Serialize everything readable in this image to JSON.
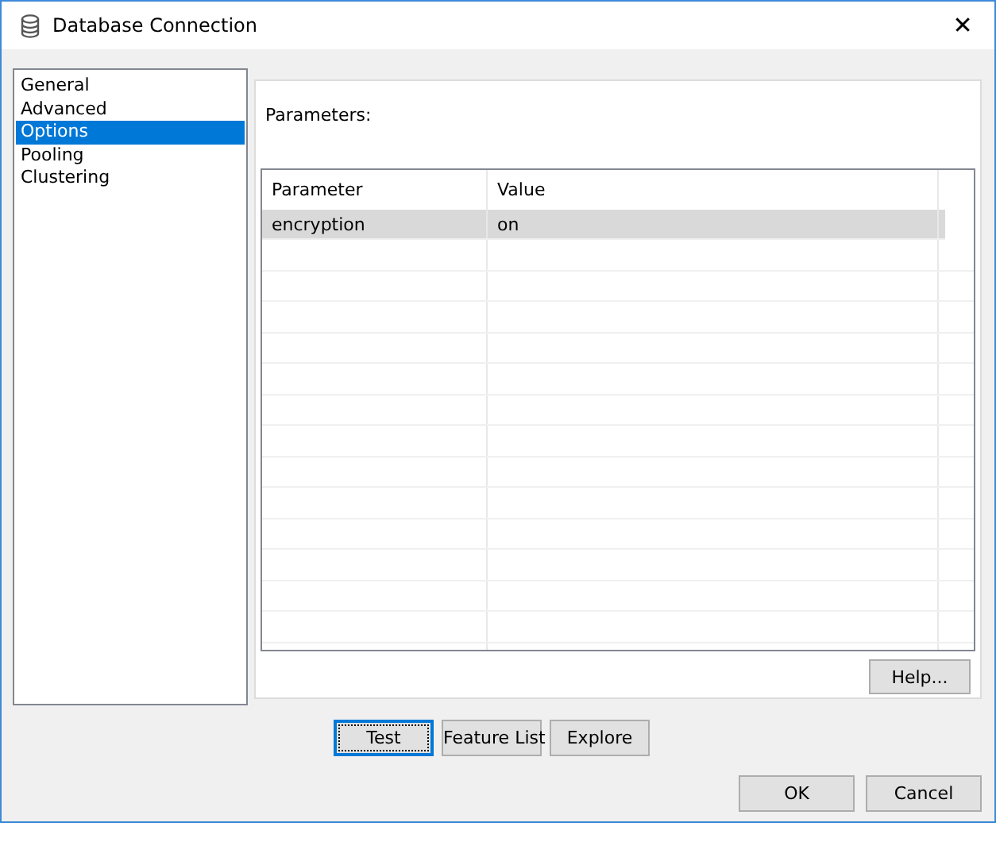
{
  "window": {
    "title": "Database Connection",
    "close": "✕"
  },
  "sidebar": {
    "items": [
      {
        "label": "General",
        "selected": false
      },
      {
        "label": "Advanced",
        "selected": false
      },
      {
        "label": "Options",
        "selected": true
      },
      {
        "label": "Pooling",
        "selected": false
      },
      {
        "label": "Clustering",
        "selected": false
      }
    ]
  },
  "panel": {
    "label": "Parameters:",
    "table": {
      "columns": [
        "Parameter",
        "Value"
      ],
      "rows": [
        {
          "cells": [
            "encryption",
            "on"
          ],
          "selected": true
        }
      ]
    },
    "help_button": "Help..."
  },
  "action_buttons": [
    {
      "label": "Test",
      "focused": true
    },
    {
      "label": "Feature List",
      "focused": false
    },
    {
      "label": "Explore",
      "focused": false
    }
  ],
  "dialog_buttons": [
    "OK",
    "Cancel"
  ]
}
